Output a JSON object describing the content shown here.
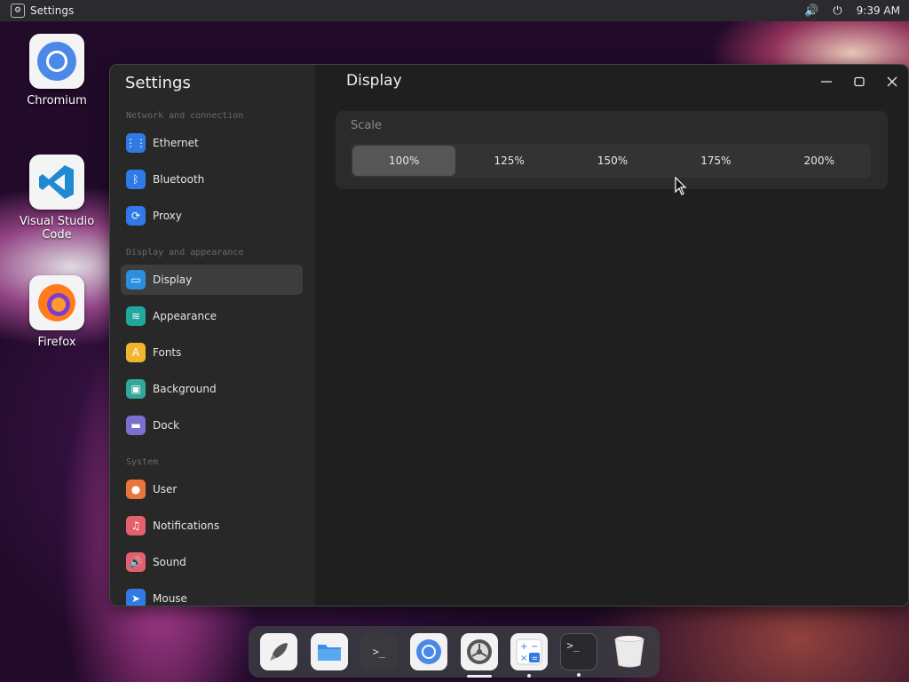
{
  "topbar": {
    "app_title": "Settings",
    "time": "9:39 AM",
    "volume_icon": "volume-icon",
    "power_icon": "power-icon"
  },
  "desktop": {
    "icons": [
      {
        "label": "Chromium",
        "icon": "chromium-icon"
      },
      {
        "label": "Visual Studio Code",
        "icon": "vscode-icon"
      },
      {
        "label": "Firefox",
        "icon": "firefox-icon"
      }
    ]
  },
  "window": {
    "sidebar_title": "Settings",
    "page_title": "Display",
    "sections": [
      {
        "title": "Network and connection",
        "items": [
          {
            "label": "Ethernet",
            "icon": "ethernet-icon",
            "color": "#2f7ae5"
          },
          {
            "label": "Bluetooth",
            "icon": "bluetooth-icon",
            "color": "#2f7ae5"
          },
          {
            "label": "Proxy",
            "icon": "proxy-icon",
            "color": "#2f7ae5"
          }
        ]
      },
      {
        "title": "Display and appearance",
        "items": [
          {
            "label": "Display",
            "icon": "display-icon",
            "color": "#2b8fe0"
          },
          {
            "label": "Appearance",
            "icon": "appearance-icon",
            "color": "#1fa89c"
          },
          {
            "label": "Fonts",
            "icon": "fonts-icon",
            "color": "#f2b530"
          },
          {
            "label": "Background",
            "icon": "background-icon",
            "color": "#33a89a"
          },
          {
            "label": "Dock",
            "icon": "dock-icon",
            "color": "#7b6fd0"
          }
        ]
      },
      {
        "title": "System",
        "items": [
          {
            "label": "User",
            "icon": "user-icon",
            "color": "#e8763b"
          },
          {
            "label": "Notifications",
            "icon": "notifications-icon",
            "color": "#e5606b"
          },
          {
            "label": "Sound",
            "icon": "sound-icon",
            "color": "#e5606b"
          },
          {
            "label": "Mouse",
            "icon": "mouse-icon",
            "color": "#2f7ae5"
          }
        ]
      }
    ],
    "scale": {
      "label": "Scale",
      "options": [
        "100%",
        "125%",
        "150%",
        "175%",
        "200%"
      ],
      "selected": "100%"
    }
  },
  "dock": {
    "items": [
      {
        "icon": "launcher-icon",
        "indicator": "none"
      },
      {
        "icon": "files-icon",
        "indicator": "none"
      },
      {
        "icon": "terminal-icon",
        "indicator": "none"
      },
      {
        "icon": "chromium-icon",
        "indicator": "none"
      },
      {
        "icon": "settings-icon",
        "indicator": "active"
      },
      {
        "icon": "calculator-icon",
        "indicator": "running"
      },
      {
        "icon": "terminal-icon",
        "indicator": "running"
      },
      {
        "icon": "trash-icon",
        "indicator": "none"
      }
    ]
  }
}
